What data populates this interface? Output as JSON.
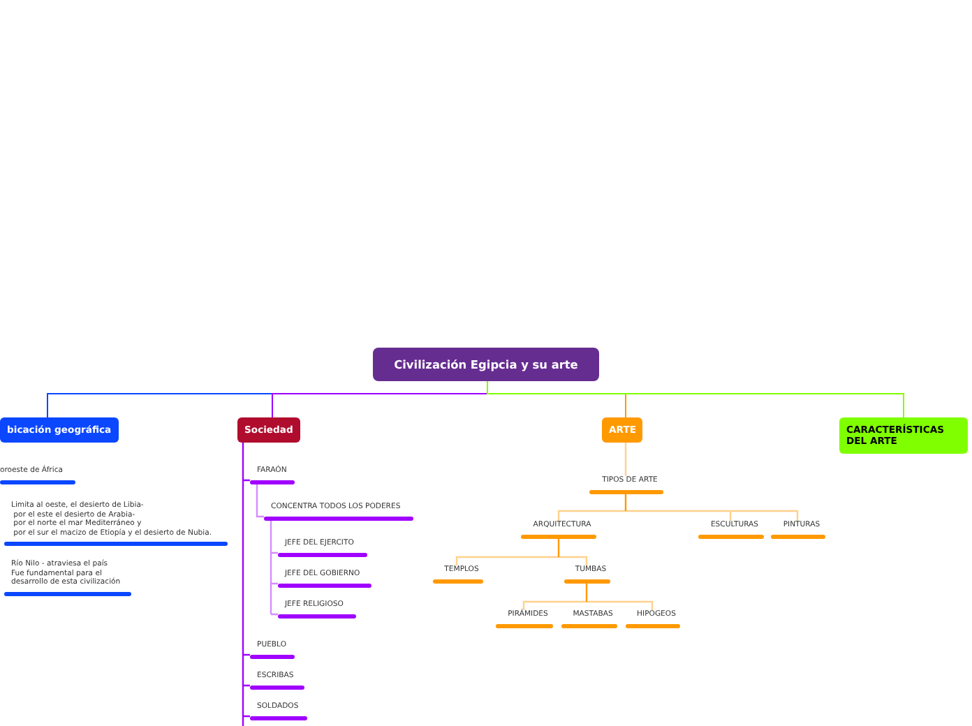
{
  "root": {
    "title": "Civilización Egipcia y su arte",
    "color": "#662d91"
  },
  "branches": [
    {
      "label": "bicación geográfica",
      "box": {
        "color": "#0a47ff"
      },
      "color": "#0a47ff",
      "children": [
        {
          "label": "oroeste de África"
        },
        {
          "label": "Limita al oeste, el desierto de Libia-\n por el este el desierto de Arabia-\n por el norte el mar Mediterráneo y\n por el sur el macizo de Etiopía y el desierto de Nubia."
        },
        {
          "label": "Río Nilo - atraviesa el país\nFue fundamental para el\ndesarrollo de esta civilización"
        }
      ]
    },
    {
      "label": "Sociedad",
      "box": {
        "color": "#b00c2e"
      },
      "color": "#a000ff",
      "children": [
        {
          "label": "FARAÓN",
          "children": [
            {
              "label": "CONCENTRA TODOS LOS PODERES",
              "children": [
                {
                  "label": "JEFE DEL EJERCITO"
                },
                {
                  "label": "JEFE DEL GOBIERNO"
                },
                {
                  "label": "JEFE RELIGIOSO"
                }
              ]
            }
          ]
        },
        {
          "label": "PUEBLO"
        },
        {
          "label": "ESCRIBAS"
        },
        {
          "label": "SOLDADOS"
        }
      ]
    },
    {
      "label": "ARTE",
      "box": {
        "color": "#ff9900"
      },
      "color": "#ff9900",
      "children": [
        {
          "label": "TIPOS DE ARTE",
          "children": [
            {
              "label": "ARQUITECTURA",
              "children": [
                {
                  "label": "TEMPLOS"
                },
                {
                  "label": "TUMBAS",
                  "children": [
                    {
                      "label": "PIRÁMIDES"
                    },
                    {
                      "label": "MASTABAS"
                    },
                    {
                      "label": "HIPOGEOS"
                    }
                  ]
                }
              ]
            },
            {
              "label": "ESCULTURAS"
            },
            {
              "label": "PINTURAS"
            }
          ]
        }
      ]
    },
    {
      "label": "CARACTERÍSTICAS DEL ARTE",
      "box": {
        "color": "#80ff00"
      },
      "color": "#80ff00"
    }
  ]
}
